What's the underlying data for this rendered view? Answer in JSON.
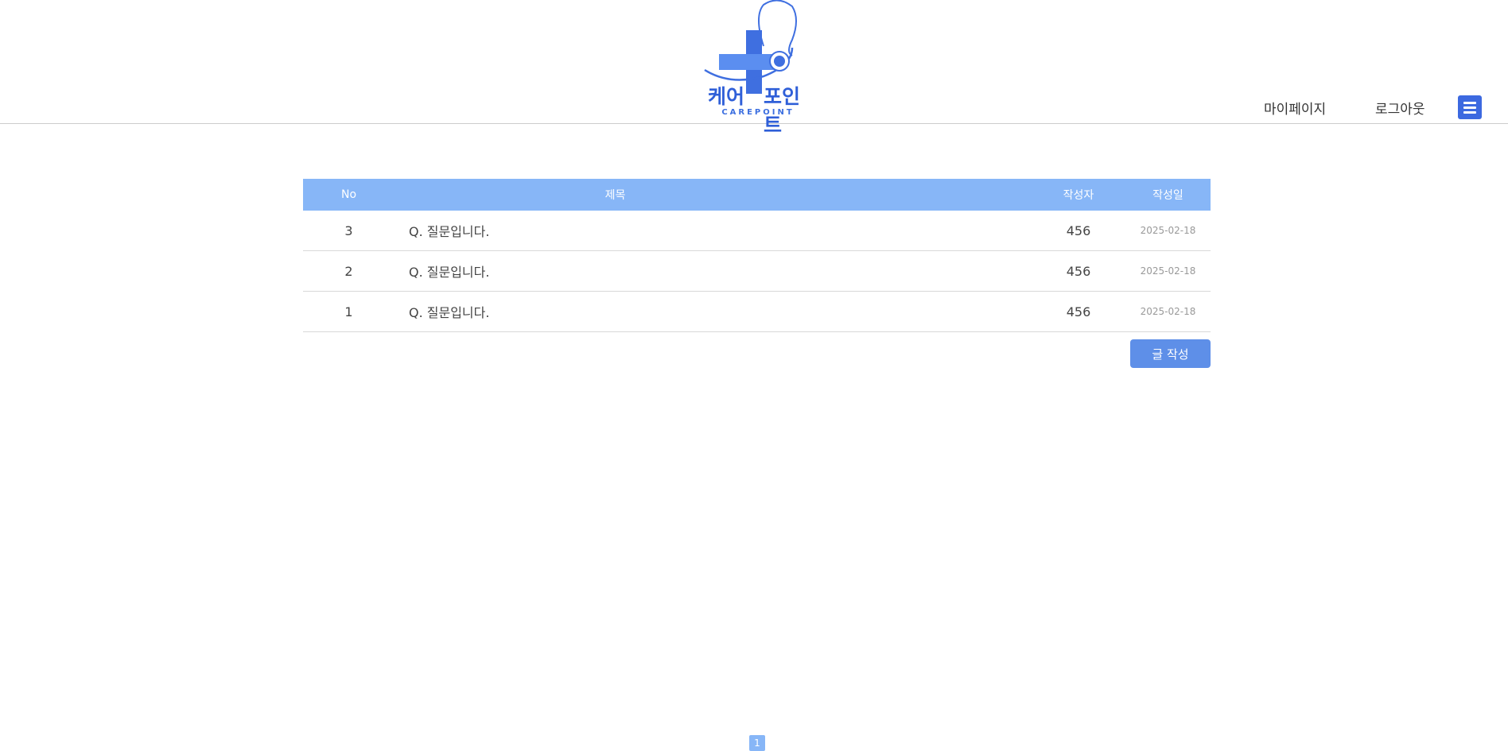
{
  "brand": {
    "name_part1": "케어",
    "name_part2": "포인트",
    "subtitle": "CAREPOINT"
  },
  "nav": {
    "mypage": "마이페이지",
    "logout": "로그아웃",
    "menu_icon": "hamburger-menu-icon"
  },
  "colors": {
    "accent": "#3c69e0",
    "table_header": "#87b6f7",
    "button": "#5e8fe8"
  },
  "table": {
    "headers": {
      "no": "No",
      "title": "제목",
      "writer": "작성자",
      "date": "작성일"
    },
    "rows": [
      {
        "no": "3",
        "title": "Q. 질문입니다.",
        "writer": "456",
        "date": "2025-02-18"
      },
      {
        "no": "2",
        "title": "Q. 질문입니다.",
        "writer": "456",
        "date": "2025-02-18"
      },
      {
        "no": "1",
        "title": "Q. 질문입니다.",
        "writer": "456",
        "date": "2025-02-18"
      }
    ]
  },
  "write_button": "글 작성",
  "pagination": {
    "current_page": "1"
  }
}
